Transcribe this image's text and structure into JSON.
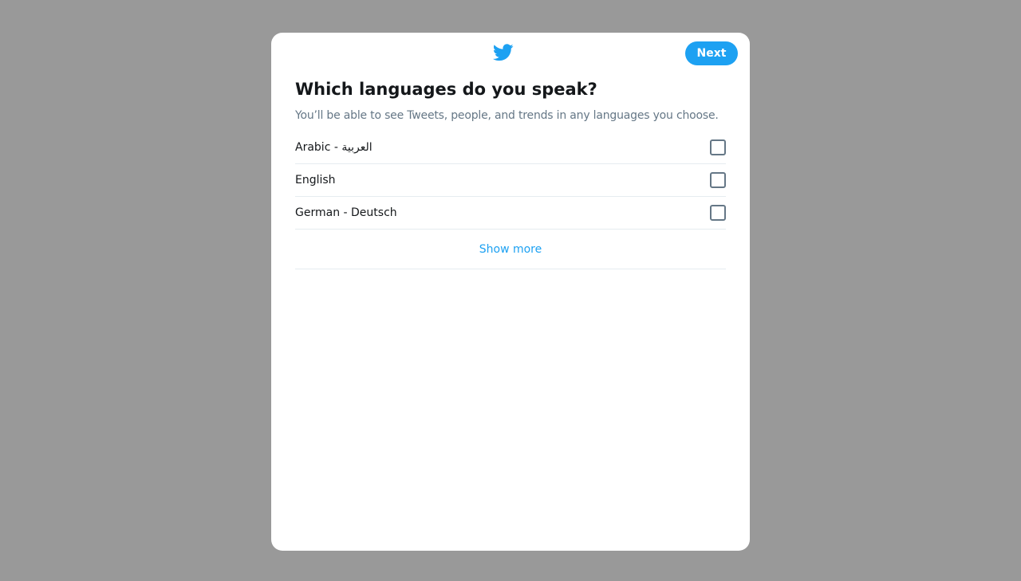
{
  "colors": {
    "backdrop": "#999999",
    "accent": "#1da1f2",
    "text_primary": "#14171a",
    "text_secondary": "#657786"
  },
  "header": {
    "logo_icon": "twitter-bird-icon",
    "next_label": "Next"
  },
  "main": {
    "title": "Which languages do you speak?",
    "subtitle": "You’ll be able to see Tweets, people, and trends in any languages you choose.",
    "languages": [
      {
        "label": "Arabic - العربية",
        "checked": false
      },
      {
        "label": "English",
        "checked": false
      },
      {
        "label": "German - Deutsch",
        "checked": false
      }
    ],
    "show_more_label": "Show more"
  }
}
